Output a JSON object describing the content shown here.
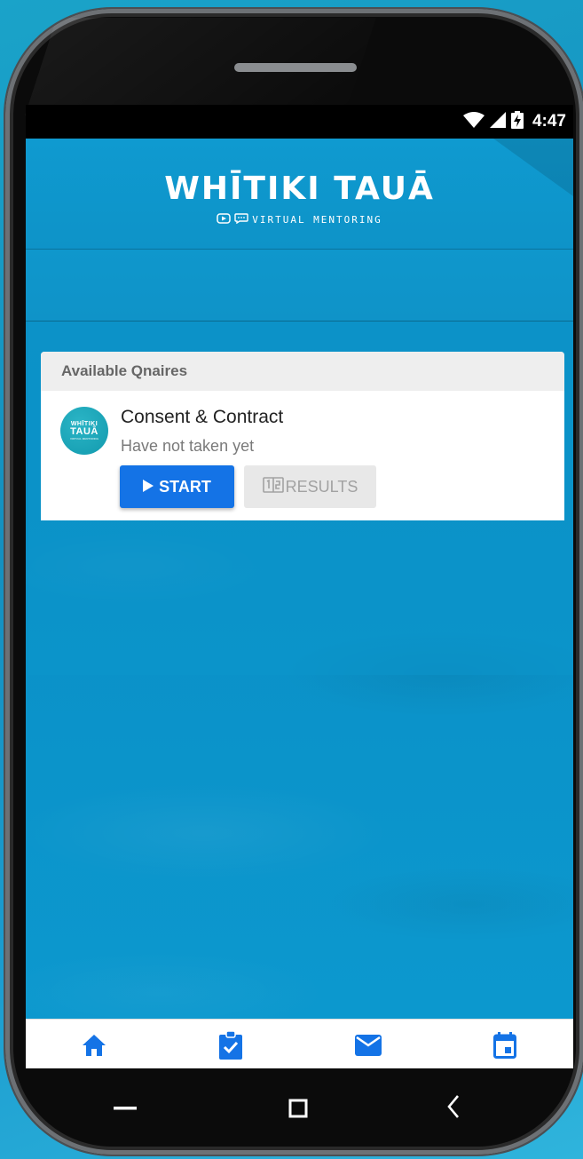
{
  "status_bar": {
    "time": "4:47",
    "icons": [
      "wifi-icon",
      "signal-icon",
      "battery-charging-icon"
    ]
  },
  "header": {
    "title": "WHĪTIKI TAUĀ",
    "subtitle": "VIRTUAL MENTORING"
  },
  "qnaires": {
    "heading": "Available Qnaires",
    "items": [
      {
        "avatar_line1": "WHĪTIKI",
        "avatar_line2": "TAUĀ",
        "avatar_line3": "VIRTUAL MENTORING",
        "title": "Consent & Contract",
        "status": "Have not taken yet",
        "start_label": "START",
        "results_label": "RESULTS"
      }
    ]
  },
  "bottom_nav": {
    "items": [
      "home-icon",
      "clipboard-check-icon",
      "mail-icon",
      "calendar-icon"
    ],
    "active_color": "#1473e6"
  },
  "colors": {
    "brand_blue": "#0f95c8",
    "button_blue": "#1473e6"
  }
}
